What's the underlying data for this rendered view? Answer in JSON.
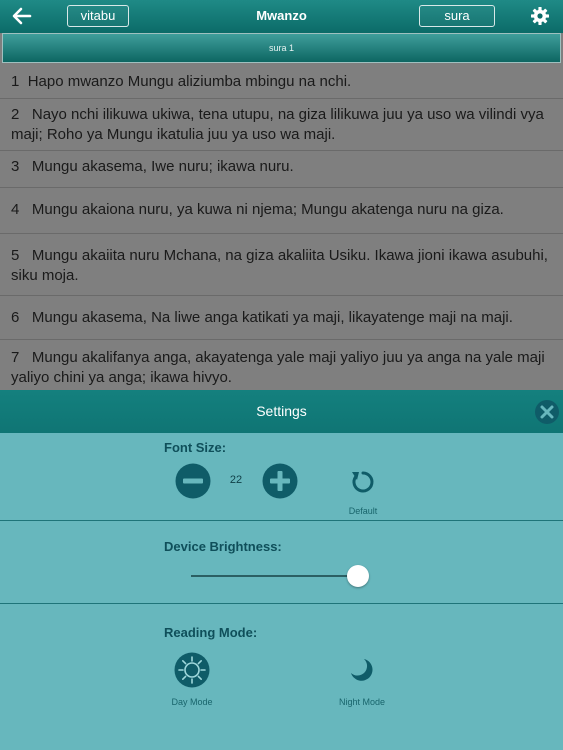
{
  "topbar": {
    "title": "Mwanzo",
    "books_label": "vitabu",
    "chapter_label": "sura"
  },
  "chapter_header": "sura 1",
  "verses": [
    {
      "number": "1",
      "text": "Hapo mwanzo Mungu aliziumba mbingu na nchi."
    },
    {
      "number": "2",
      "text": "Nayo nchi ilikuwa ukiwa, tena utupu, na giza lilikuwa juu ya uso wa vilindi vya maji; Roho ya Mungu ikatulia juu ya uso wa maji."
    },
    {
      "number": "3",
      "text": "Mungu akasema, Iwe nuru; ikawa nuru."
    },
    {
      "number": "4",
      "text": "Mungu akaiona nuru, ya kuwa ni njema; Mungu akatenga nuru na giza."
    },
    {
      "number": "5",
      "text": "Mungu akaiita nuru Mchana, na giza akaliita Usiku. Ikawa jioni ikawa asubuhi, siku moja."
    },
    {
      "number": "6",
      "text": "Mungu akasema, Na liwe anga katikati ya maji, likayatenge maji na maji."
    },
    {
      "number": "7",
      "text": "Mungu akalifanya anga, akayatenga yale maji yaliyo juu ya anga na yale maji yaliyo chini ya anga; ikawa hivyo."
    }
  ],
  "settings": {
    "title": "Settings",
    "font_size_label": "Font Size:",
    "font_size_value": "22",
    "default_label": "Default",
    "brightness_label": "Device Brightness:",
    "brightness_level": 1.0,
    "reading_mode_label": "Reading Mode:",
    "day_mode_label": "Day Mode",
    "night_mode_label": "Night Mode"
  },
  "colors": {
    "topbar": "#0b6b68",
    "panel": "#67b7bd",
    "icon_dark": "#0f5c68"
  }
}
